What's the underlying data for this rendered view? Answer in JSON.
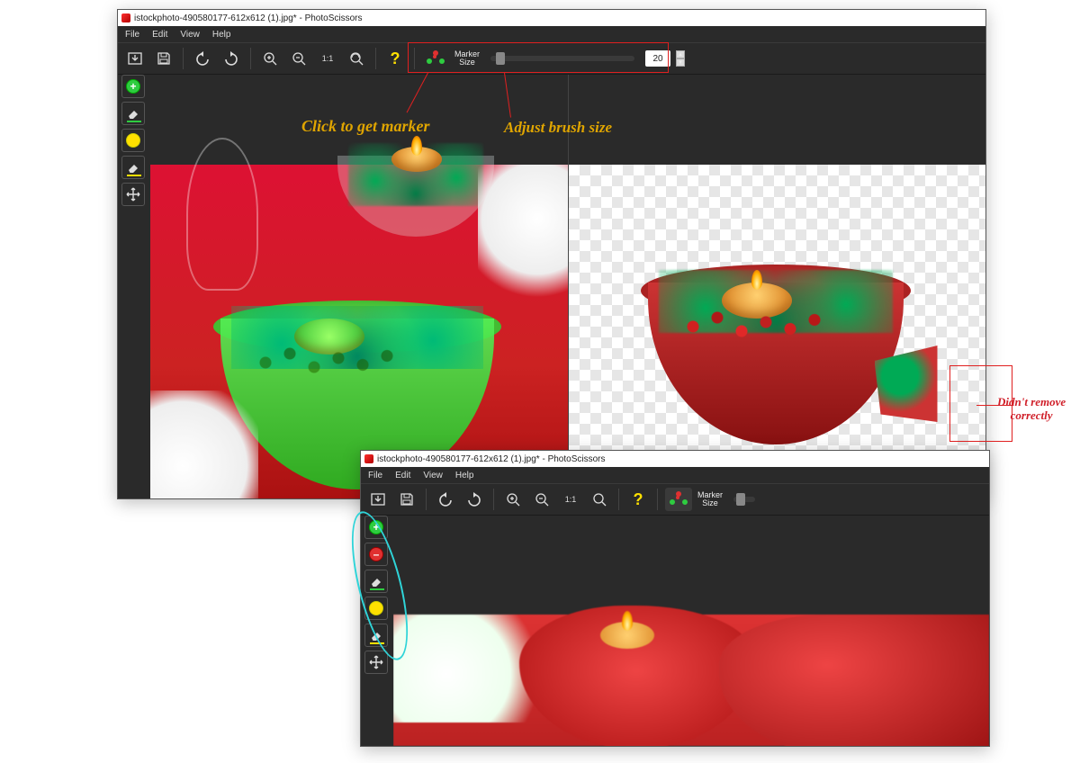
{
  "window1": {
    "title": "istockphoto-490580177-612x612 (1).jpg* - PhotoScissors",
    "menu": {
      "file": "File",
      "edit": "Edit",
      "view": "View",
      "help": "Help"
    },
    "toolbar": {
      "marker_label_line1": "Marker",
      "marker_label_line2": "Size",
      "brush_size": "20"
    }
  },
  "window2": {
    "title": "istockphoto-490580177-612x612 (1).jpg* - PhotoScissors",
    "menu": {
      "file": "File",
      "edit": "Edit",
      "view": "View",
      "help": "Help"
    },
    "toolbar": {
      "marker_label_line1": "Marker",
      "marker_label_line2": "Size"
    }
  },
  "annotations": {
    "click_marker": "Click to get marker",
    "adjust_brush": "Adjust brush size",
    "didnt_remove_1": "Didn't remove",
    "didnt_remove_2": "correctly"
  },
  "colors": {
    "accent_yellow": "#e0a500",
    "accent_red": "#d0202a"
  }
}
